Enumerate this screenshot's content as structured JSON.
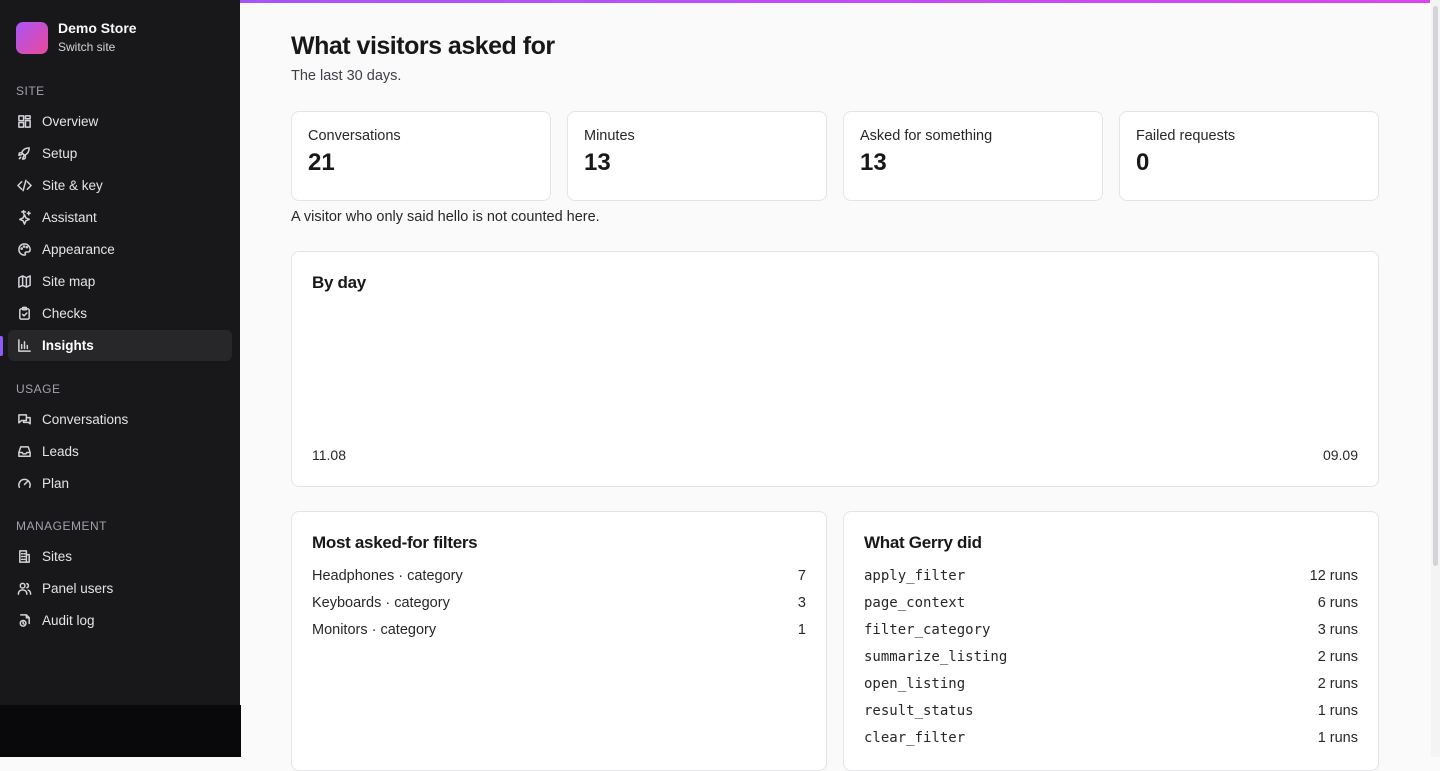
{
  "brand": {
    "name": "Demo Store",
    "switch_label": "Switch site"
  },
  "sidebar": {
    "sections": [
      {
        "title": "SITE",
        "items": [
          {
            "label": "Overview",
            "icon": "grid-icon"
          },
          {
            "label": "Setup",
            "icon": "rocket-icon"
          },
          {
            "label": "Site & key",
            "icon": "code-icon"
          },
          {
            "label": "Assistant",
            "icon": "sparkles-icon"
          },
          {
            "label": "Appearance",
            "icon": "palette-icon"
          },
          {
            "label": "Site map",
            "icon": "map-icon"
          },
          {
            "label": "Checks",
            "icon": "clipboard-check-icon"
          },
          {
            "label": "Insights",
            "icon": "bar-chart-icon",
            "active": true
          }
        ]
      },
      {
        "title": "USAGE",
        "items": [
          {
            "label": "Conversations",
            "icon": "chat-icon"
          },
          {
            "label": "Leads",
            "icon": "inbox-icon"
          },
          {
            "label": "Plan",
            "icon": "gauge-icon"
          }
        ]
      },
      {
        "title": "MANAGEMENT",
        "items": [
          {
            "label": "Sites",
            "icon": "building-icon"
          },
          {
            "label": "Panel users",
            "icon": "users-icon"
          },
          {
            "label": "Audit log",
            "icon": "log-icon"
          }
        ]
      }
    ]
  },
  "page": {
    "title": "What visitors asked for",
    "subtitle": "The last 30 days."
  },
  "stats": [
    {
      "label": "Conversations",
      "value": "21"
    },
    {
      "label": "Minutes",
      "value": "13"
    },
    {
      "label": "Asked for something",
      "value": "13"
    },
    {
      "label": "Failed requests",
      "value": "0"
    }
  ],
  "note": "A visitor who only said hello is not counted here.",
  "by_day": {
    "title": "By day",
    "start_label": "11.08",
    "end_label": "09.09"
  },
  "filters": {
    "title": "Most asked-for filters",
    "rows": [
      {
        "label": "Headphones · category",
        "count": "7"
      },
      {
        "label": "Keyboards · category",
        "count": "3"
      },
      {
        "label": "Monitors · category",
        "count": "1"
      }
    ]
  },
  "actions": {
    "title": "What Gerry did",
    "rows": [
      {
        "name": "apply_filter",
        "runs": "12 runs"
      },
      {
        "name": "page_context",
        "runs": "6 runs"
      },
      {
        "name": "filter_category",
        "runs": "3 runs"
      },
      {
        "name": "summarize_listing",
        "runs": "2 runs"
      },
      {
        "name": "open_listing",
        "runs": "2 runs"
      },
      {
        "name": "result_status",
        "runs": "1 runs"
      },
      {
        "name": "clear_filter",
        "runs": "1 runs"
      }
    ]
  },
  "colors": {
    "accent": "#8b5cf6",
    "sidebar_bg": "#18181b",
    "page_bg": "#fafafa"
  }
}
